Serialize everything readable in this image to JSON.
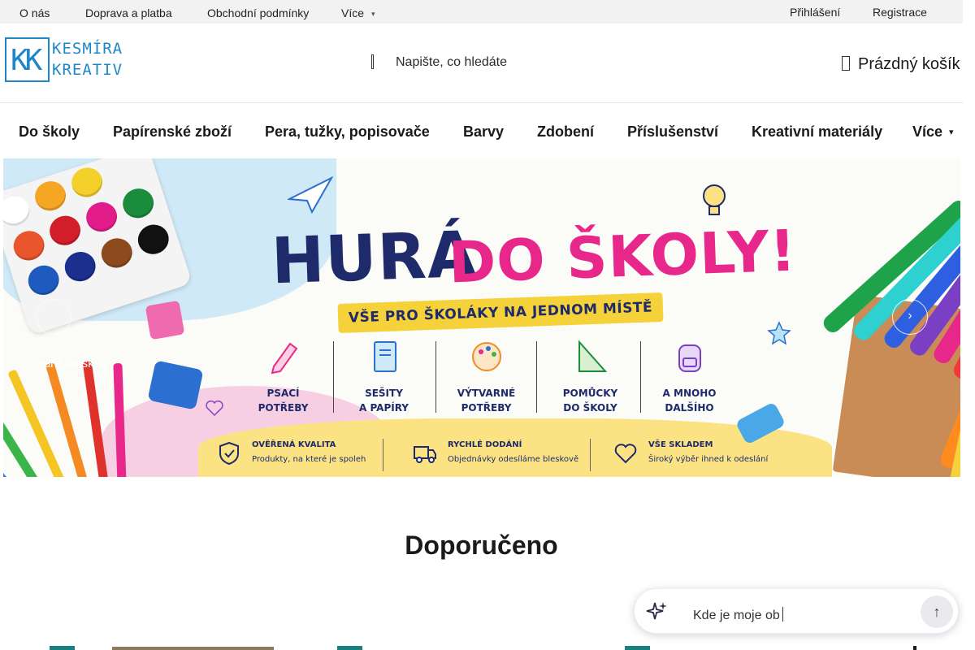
{
  "topbar": {
    "about": "O nás",
    "shipping": "Doprava a platba",
    "terms": "Obchodní podmínky",
    "more": "Více",
    "login": "Přihlášení",
    "register": "Registrace"
  },
  "header": {
    "logo_kk": "KK",
    "logo_word1": "KESMÍRA",
    "logo_word2": "KREATIV",
    "search_placeholder": "Napište, co hledáte",
    "cart_label": "Prázdný košík"
  },
  "categories": [
    "Do školy",
    "Papírenské zboží",
    "Pera, tužky, popisovače",
    "Barvy",
    "Zdobení",
    "Příslušenství",
    "Kreativní materiály",
    "Více"
  ],
  "banner": {
    "title_part1": "HURÁ",
    "title_part2": "DO ŠKOLY!",
    "ribbon": "VŠE PRO ŠKOLÁKY NA JEDNOM MÍSTĚ",
    "caption": "Hurá do školy",
    "tiles": [
      {
        "l1": "PSACÍ",
        "l2": "POTŘEBY"
      },
      {
        "l1": "SEŠITY",
        "l2": "A PAPÍRY"
      },
      {
        "l1": "VÝTVARNÉ",
        "l2": "POTŘEBY"
      },
      {
        "l1": "POMŮCKY",
        "l2": "DO ŠKOLY"
      },
      {
        "l1": "A MNOHO",
        "l2": "DALŠÍHO"
      }
    ],
    "features": [
      {
        "title": "OVĚŘENÁ KVALITA",
        "sub": "Produkty, na které je spoleh"
      },
      {
        "title": "RYCHLÉ DODÁNÍ",
        "sub": "Objednávky odesíláme bleskově"
      },
      {
        "title": "VŠE SKLADEM",
        "sub": "Široký výběr ihned k odeslání"
      }
    ]
  },
  "recommended": {
    "title": "Doporučeno"
  },
  "chat": {
    "text": "Kde je moje ob"
  },
  "colors": {
    "brand_blue": "#1f87c8",
    "navy": "#1f2a6b",
    "pink": "#e8278a",
    "badge_teal": "#1a7f7f"
  }
}
